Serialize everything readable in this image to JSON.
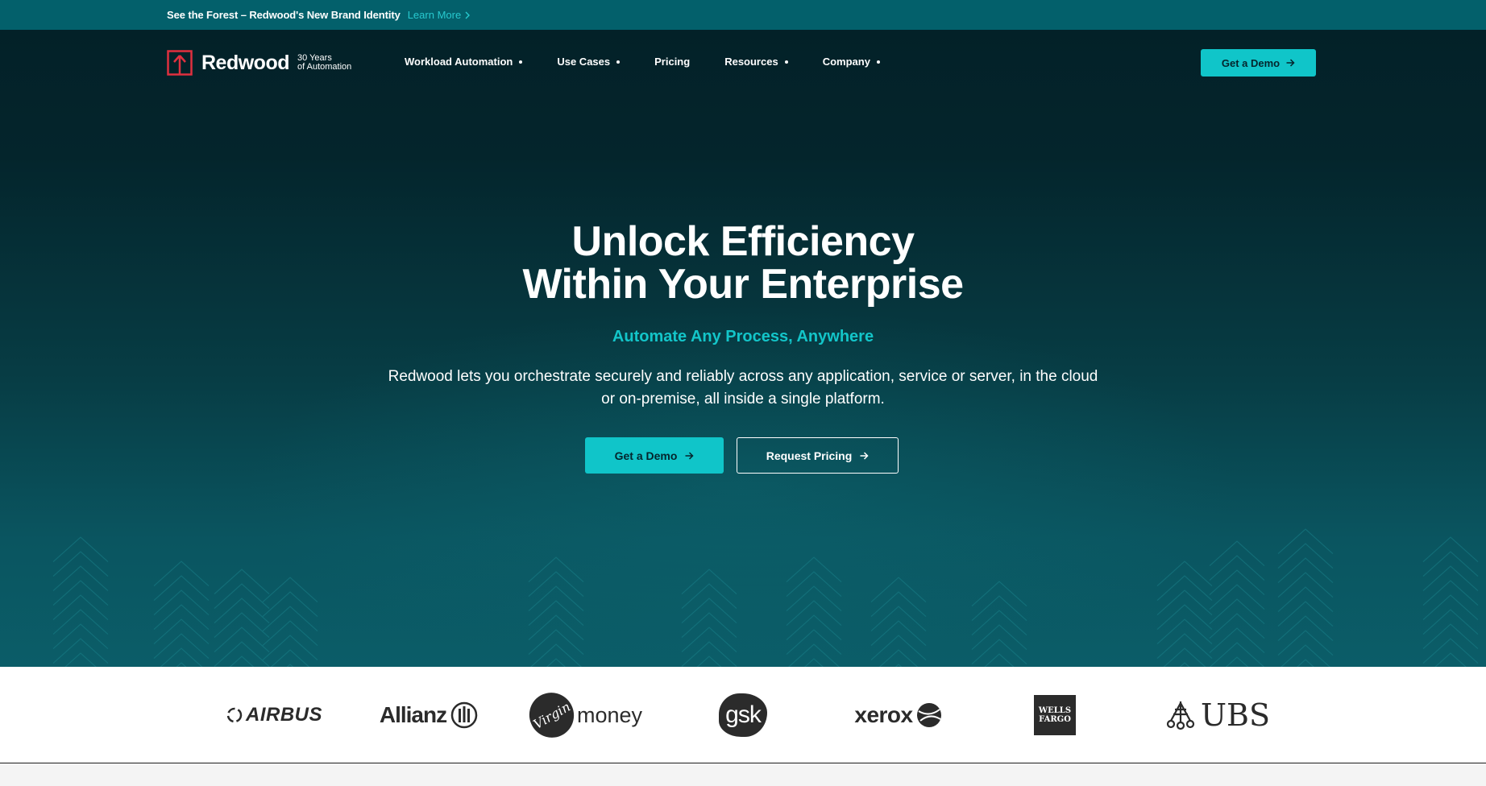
{
  "announcement": {
    "text": "See the Forest – Redwood's New Brand Identity",
    "link_label": "Learn More"
  },
  "header": {
    "brand": "Redwood",
    "tagline_line1": "30 Years",
    "tagline_line2": "of Automation",
    "nav": [
      {
        "label": "Workload Automation",
        "has_dropdown": true
      },
      {
        "label": "Use Cases",
        "has_dropdown": true
      },
      {
        "label": "Pricing",
        "has_dropdown": false
      },
      {
        "label": "Resources",
        "has_dropdown": true
      },
      {
        "label": "Company",
        "has_dropdown": true
      }
    ],
    "cta_label": "Get a Demo"
  },
  "hero": {
    "title_line1": "Unlock Efficiency",
    "title_line2": "Within Your Enterprise",
    "subtitle": "Automate Any Process, Anywhere",
    "description": "Redwood lets you orchestrate securely and reliably across any application, service or server, in the cloud or on-premise, all inside a single platform.",
    "primary_button": "Get a Demo",
    "secondary_button": "Request Pricing"
  },
  "clients": {
    "airbus": "AIRBUS",
    "allianz": "Allianz",
    "virgin_money": "money",
    "virgin_script": "Virgin",
    "gsk": "gsk",
    "xerox": "xerox",
    "wells_fargo_line1": "WELLS",
    "wells_fargo_line2": "FARGO",
    "ubs": "UBS"
  },
  "colors": {
    "accent": "#10c5c9",
    "announce_bg": "#03606b",
    "hero_dark": "#032128",
    "logo_red": "#e0303f"
  },
  "icons": [
    "redwood-logo-icon",
    "chevron-right-icon",
    "arrow-right-icon",
    "caret-down-icon"
  ]
}
